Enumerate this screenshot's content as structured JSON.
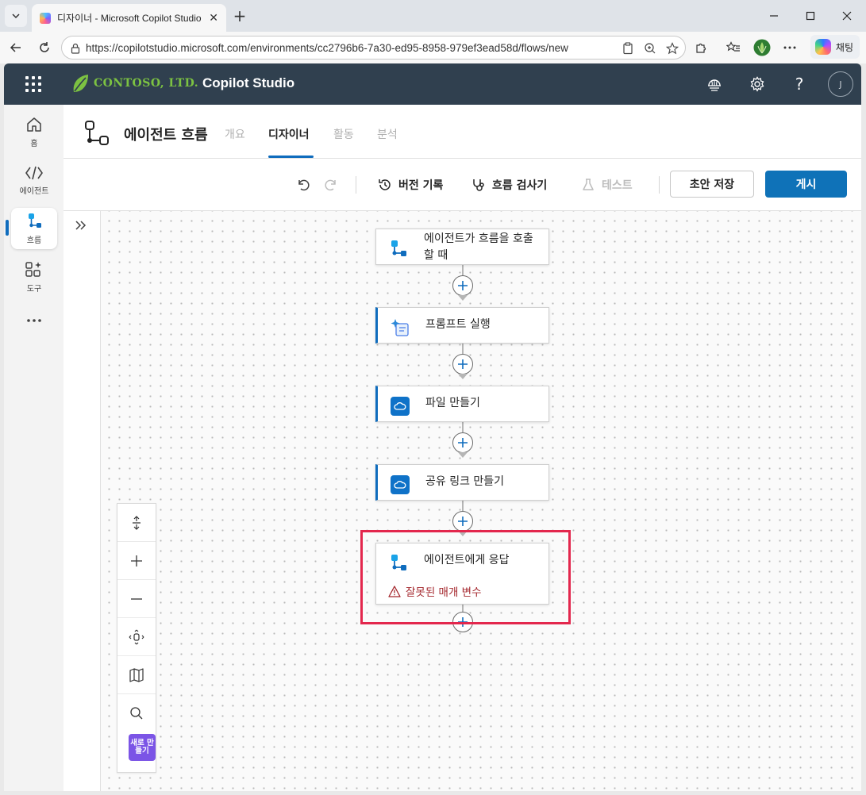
{
  "browser": {
    "tab_title": "디자이너 - Microsoft Copilot Studio",
    "url": "https://copilotstudio.microsoft.com/environments/cc2796b6-7a30-ed95-8958-979ef3ead58d/flows/new",
    "chat_label": "채팅"
  },
  "header": {
    "logo_text": "CONTOSO, LTD.",
    "product_name": "Copilot Studio",
    "avatar_initial": "J"
  },
  "rail": {
    "items": [
      {
        "label": "홈"
      },
      {
        "label": "에이전트"
      },
      {
        "label": "흐름"
      },
      {
        "label": "도구"
      }
    ]
  },
  "page": {
    "title": "에이전트 흐름",
    "tabs": [
      {
        "label": "개요"
      },
      {
        "label": "디자이너"
      },
      {
        "label": "활동"
      },
      {
        "label": "분석"
      }
    ]
  },
  "toolbar": {
    "version_history": "버전 기록",
    "flow_checker": "흐름 검사기",
    "test": "테스트",
    "save_draft": "초안 저장",
    "publish": "게시"
  },
  "flow": {
    "nodes": [
      {
        "title": "에이전트가 흐름을 호출할 때",
        "icon": "agent-flow-icon"
      },
      {
        "title": "프롬프트 실행",
        "icon": "ai-prompt-icon"
      },
      {
        "title": "파일 만들기",
        "icon": "onedrive-icon"
      },
      {
        "title": "공유 링크 만들기",
        "icon": "onedrive-icon"
      },
      {
        "title": "에이전트에게 응답",
        "icon": "agent-flow-icon",
        "error": "잘못된 매개 변수"
      }
    ]
  },
  "canvas_controls": {
    "new_badge": "새로 만들기"
  },
  "colors": {
    "accent": "#0f6cbd",
    "header_bg": "#30404f",
    "error": "#a4262c",
    "highlight": "#e3274d"
  }
}
